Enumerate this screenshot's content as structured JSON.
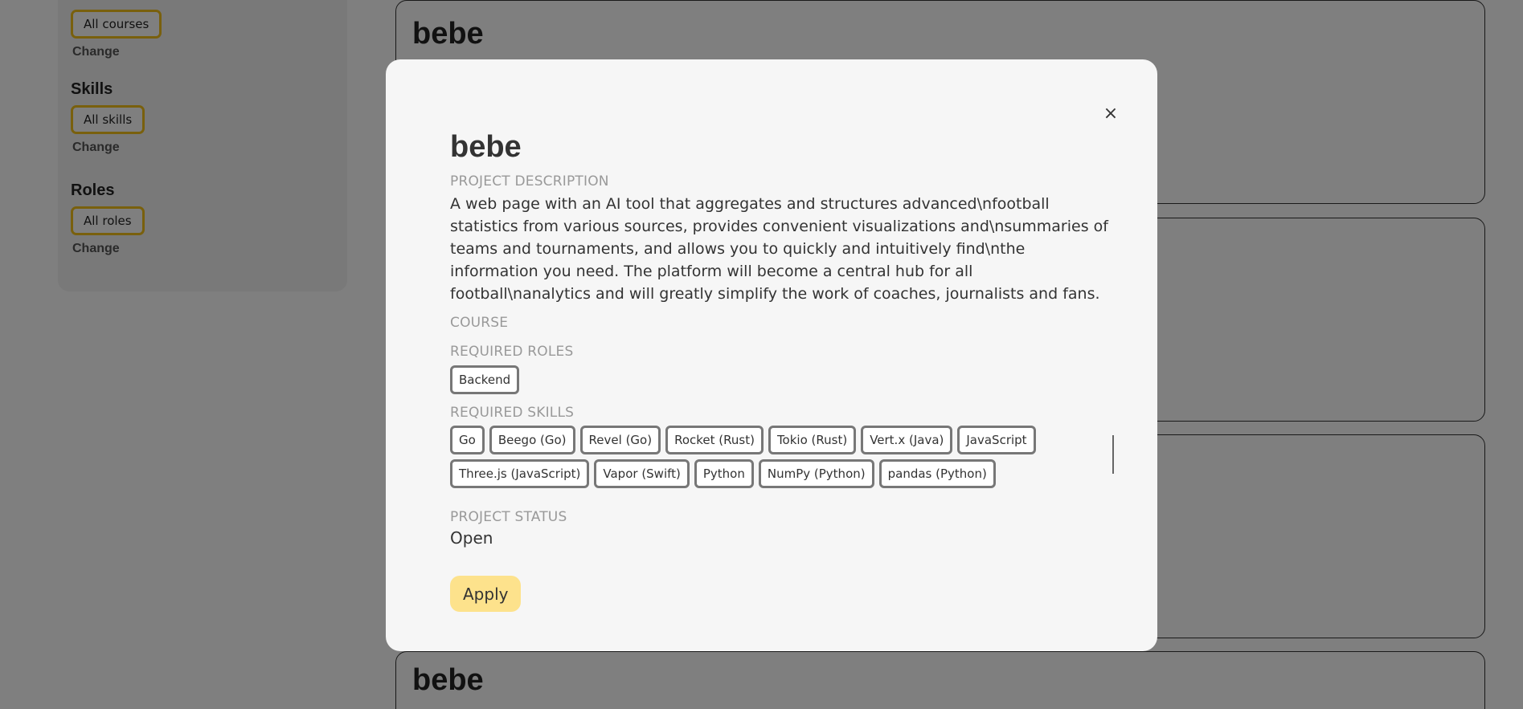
{
  "sidebar": {
    "courses": {
      "chip": "All courses",
      "change": "Change"
    },
    "skills": {
      "title": "Skills",
      "chip": "All skills",
      "change": "Change"
    },
    "roles": {
      "title": "Roles",
      "chip": "All roles",
      "change": "Change"
    }
  },
  "cards": [
    {
      "title": "bebe"
    },
    {
      "title": ""
    },
    {
      "title": ""
    },
    {
      "title": "bebe"
    }
  ],
  "modal": {
    "close_label": "×",
    "title": "bebe",
    "description_label": "PROJECT DESCRIPTION",
    "description": "A web page with an AI tool that aggregates and structures advanced\\nfootball statistics from various sources, provides convenient visualizations and\\nsummaries of teams and tournaments, and allows you to quickly and intuitively find\\nthe information you need. The platform will become a central hub for all football\\nanalytics and will greatly simplify the work of coaches, journalists and fans.",
    "course_label": "COURSE",
    "roles_label": "REQUIRED ROLES",
    "roles": [
      "Backend"
    ],
    "skills_label": "REQUIRED SKILLS",
    "skills": [
      "Go",
      "Beego (Go)",
      "Revel (Go)",
      "Rocket (Rust)",
      "Tokio (Rust)",
      "Vert.x (Java)",
      "JavaScript",
      "Three.js (JavaScript)",
      "Vapor (Swift)",
      "Python",
      "NumPy (Python)",
      "pandas (Python)"
    ],
    "status_label": "PROJECT STATUS",
    "status": "Open",
    "apply_label": "Apply"
  },
  "colors": {
    "accent": "#f3c11b",
    "apply_bg": "#fde28c",
    "overlay": "rgba(0,0,0,0.5)"
  }
}
